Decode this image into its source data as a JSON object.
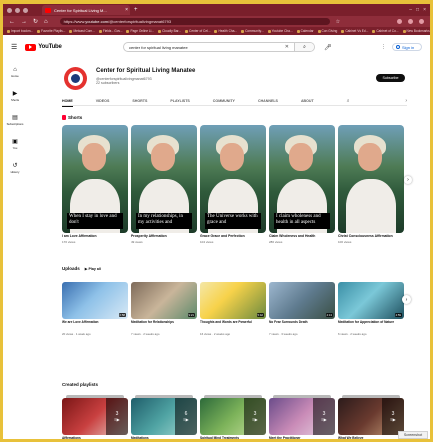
{
  "browser": {
    "tab_label": "Center for Spiritual Living M...",
    "url_prefix": "https://www.",
    "url_domain": "youtube.com",
    "url_rest": "/@centerforspiritualivingmanat6793",
    "bookmarks": [
      "Import bookm...",
      "Favorite Playlis...",
      "Metcast Com...",
      "Fields - Gov...",
      "Page Online Li...",
      "Cloudly Bar...",
      "Center of Cel...",
      "Health Cha...",
      "Community...",
      "Youtube Cha...",
      "Calendar",
      "Con Giving",
      "Cabinet Vs Ed...",
      "Cabinet of Co...",
      "New Bookmarks"
    ]
  },
  "header": {
    "logo_text": "YouTube",
    "search_value": "center for spiritual living manatee",
    "signin_label": "Sign in"
  },
  "sidebar": {
    "items": [
      {
        "icon": "home-icon",
        "label": "Home"
      },
      {
        "icon": "shorts-icon",
        "label": "Shorts"
      },
      {
        "icon": "subscriptions-icon",
        "label": "Subscriptions"
      },
      {
        "icon": "library-icon",
        "label": "You"
      },
      {
        "icon": "history-icon",
        "label": "History"
      }
    ]
  },
  "channel": {
    "name": "Center for Spiritual Living Manatee",
    "handle": "@centerforspiritualivingmanat6793",
    "subscribers": "22 subscribers",
    "subscribe_label": "Subscribe"
  },
  "tabs": [
    "HOME",
    "VIDEOS",
    "SHORTS",
    "PLAYLISTS",
    "COMMUNITY",
    "CHANNELS",
    "ABOUT"
  ],
  "shorts_section": {
    "title": "Shorts",
    "items": [
      {
        "caption": "When I stay in love and don't",
        "title": "I am Love Affirmation",
        "views": "170 views"
      },
      {
        "caption": "In my relationships, in my activities and",
        "title": "Prosperity Affirmation",
        "views": "49 views"
      },
      {
        "caption": "The Universe works with grace and",
        "title": "Grace Grace and Perfection",
        "views": "104 views"
      },
      {
        "caption": "I claim wholeness and health in all aspects",
        "title": "Claim Wholeness and Health",
        "views": "286 views"
      },
      {
        "caption": "",
        "title": "Christ Consciousness Affirmation",
        "views": "100 views"
      }
    ]
  },
  "uploads_section": {
    "title": "Uploads",
    "play_all": "Play all",
    "items": [
      {
        "title": "We are Love Affirmation",
        "meta": "20 views · 1 week ago",
        "duration": "0:58"
      },
      {
        "title": "Meditation for Relationships",
        "meta": "7 views · 2 weeks ago",
        "duration": "9:21"
      },
      {
        "title": "Thoughts and Words are Powerful",
        "meta": "16 views · 2 weeks ago",
        "duration": "5:42"
      },
      {
        "title": "No Fear Surrounds Death",
        "meta": "7 views · 3 weeks ago",
        "duration": "4:13"
      },
      {
        "title": "Meditation for Appreciation of Nature",
        "meta": "6 views · 2 weeks ago",
        "duration": "4:59"
      }
    ]
  },
  "playlists_section": {
    "title": "Created playlists",
    "items": [
      {
        "title": "Affirmations",
        "count": "3"
      },
      {
        "title": "Meditations",
        "count": "6"
      },
      {
        "title": "Spiritual Mind Treatments",
        "count": "3"
      },
      {
        "title": "Meet the Practitioner",
        "count": "3"
      },
      {
        "title": "What We Believe",
        "count": "3"
      }
    ]
  },
  "screenshot_tag": "Screenshot"
}
